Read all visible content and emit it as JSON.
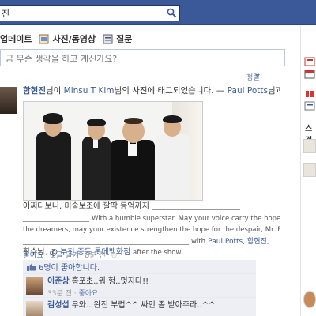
{
  "search": {
    "value": "진"
  },
  "composer": {
    "tabs": [
      {
        "label": "업데이트",
        "icon": "status-icon"
      },
      {
        "label": "사진/동영상",
        "icon": "photo-icon"
      },
      {
        "label": "질문",
        "icon": "question-icon"
      }
    ],
    "placeholder": "금 무슨 생각을 하고 계신가요?"
  },
  "feed": {
    "sort_label": "정렬"
  },
  "story": {
    "actor": "함현진",
    "head_mid": "님이 ",
    "owner": "Minsu T Kim",
    "head_tail": "님의 사진에 태그되었습니다. — ",
    "with": "Paul Potts",
    "head_end": "님과 함께",
    "caption": {
      "line1_text": "어쩌다보니, 미술보조에 깔딱 등억까지",
      "line2_text": "With a humble superstar. May your voice carry the hope for",
      "line3_text": "the dreamers, may your existence strengthen the hope for the despair, Mr. Potts.",
      "line4_text": "with",
      "line4_links": "Paul Potts, 함현진,",
      "line5_a": "황수님.",
      "line5_at": " @ ",
      "line5_place": "부천 중동 롯데백화점",
      "line5_tail": " after the show."
    },
    "actions": {
      "like": "좋아요",
      "comment": "댓글 달기",
      "time": "8분 전"
    },
    "likes_text": "6명이 좋아합니다.",
    "comments": [
      {
        "author": "이준상",
        "text": "홍포초..워 헝..멋지다!!",
        "time": "33분 전",
        "like": "좋아요"
      },
      {
        "author": "김성섭",
        "text": "우와...완전 부럽^^ 싸인 좀 받아주라..^^",
        "time": "",
        "like": ""
      }
    ]
  },
  "rail": {
    "section_label": "스걱"
  },
  "colors": {
    "brand": "#3b5998",
    "link": "#3b5998"
  }
}
